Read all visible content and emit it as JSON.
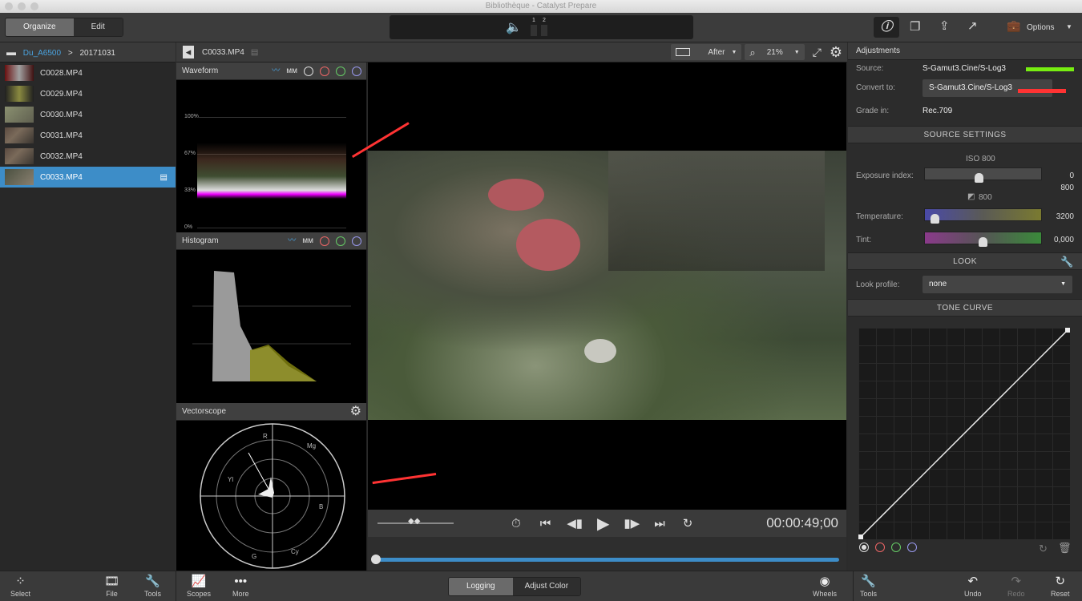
{
  "window": {
    "title": "Bibliothèque - Catalyst Prepare"
  },
  "toolbar": {
    "organize": "Organize",
    "edit": "Edit",
    "options": "Options",
    "channels": [
      "1",
      "2"
    ]
  },
  "breadcrumb": {
    "folder": "Du_A6500",
    "sub": "20171031"
  },
  "files": [
    "C0028.MP4",
    "C0029.MP4",
    "C0030.MP4",
    "C0031.MP4",
    "C0032.MP4",
    "C0033.MP4"
  ],
  "selected_file": "C0033.MP4",
  "viewer": {
    "clip": "C0033.MP4",
    "mode": "After",
    "zoom": "21%",
    "timecode": "00:00:49;00",
    "progress": 0.0
  },
  "scopes": {
    "waveform": "Waveform",
    "histogram": "Histogram",
    "vectorscope": "Vectorscope",
    "wave_ticks": [
      "100%",
      "67%",
      "33%",
      "0%"
    ],
    "vector_labels": [
      "R",
      "Mg",
      "B",
      "Cy",
      "G",
      "Yl"
    ]
  },
  "adjustments": {
    "title": "Adjustments",
    "source_label": "Source:",
    "source": "S-Gamut3.Cine/S-Log3",
    "convert_label": "Convert to:",
    "convert": "S-Gamut3.Cine/S-Log3",
    "grade_label": "Grade in:",
    "grade": "Rec.709",
    "source_settings": "SOURCE SETTINGS",
    "iso": "ISO 800",
    "exposure_label": "Exposure index:",
    "exposure_value": "0",
    "exposure_iso": "800",
    "exposure_sub": "800",
    "temp_label": "Temperature:",
    "temp_value": "3200",
    "tint_label": "Tint:",
    "tint_value": "0,000",
    "look": "LOOK",
    "look_label": "Look profile:",
    "look_value": "none",
    "tone_curve": "TONE CURVE"
  },
  "bottom": {
    "select": "Select",
    "file": "File",
    "tools": "Tools",
    "scopes": "Scopes",
    "more": "More",
    "logging": "Logging",
    "adjust_color": "Adjust Color",
    "wheels": "Wheels",
    "tools2": "Tools",
    "undo": "Undo",
    "redo": "Redo",
    "reset": "Reset"
  }
}
